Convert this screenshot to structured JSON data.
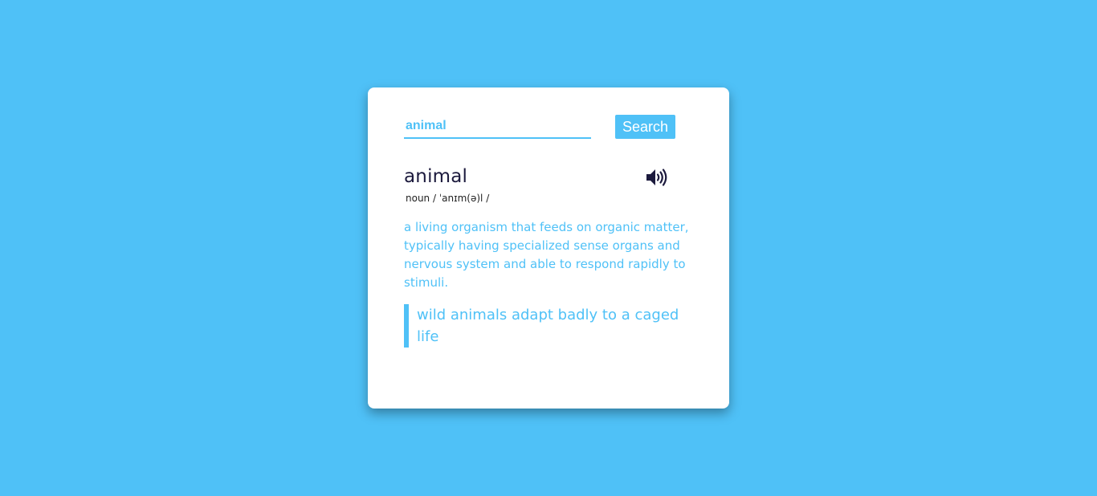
{
  "search": {
    "value": "animal",
    "button_label": "Search"
  },
  "entry": {
    "word": "animal",
    "part_of_speech": "noun",
    "separator_1": "/",
    "phonetic": "ˈanɪm(ə)l",
    "separator_2": "/",
    "definition": "a living organism that feeds on organic matter, typically having specialized sense organs and nervous system and able to respond rapidly to stimuli.",
    "example": "wild animals adapt badly to a caged life"
  },
  "icons": {
    "audio": "speaker-volume-icon"
  },
  "colors": {
    "background": "#4fc1f7",
    "accent": "#4fc1f7",
    "title": "#1c1a3d",
    "card": "#ffffff"
  }
}
